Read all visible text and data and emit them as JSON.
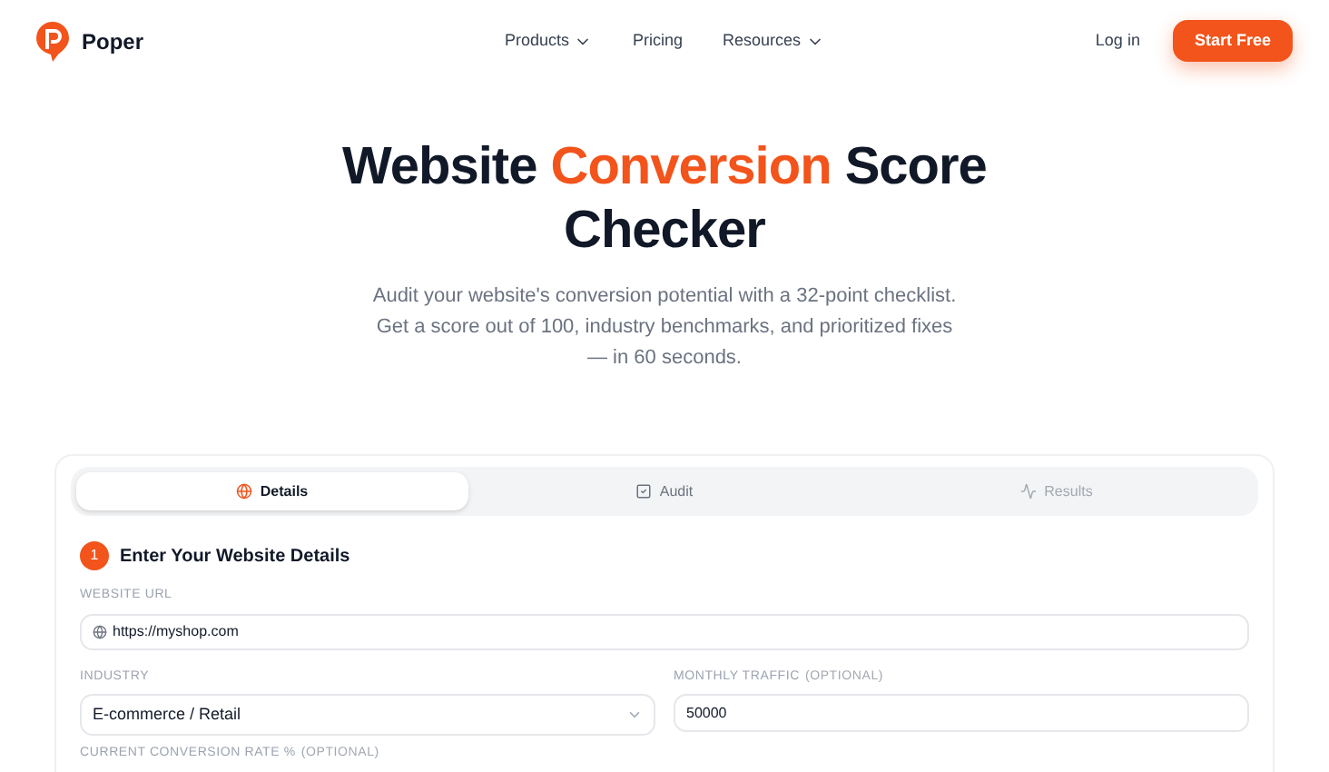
{
  "brand": {
    "name": "Poper"
  },
  "nav": [
    {
      "label": "Products",
      "dropdown": true
    },
    {
      "label": "Pricing",
      "dropdown": false
    },
    {
      "label": "Resources",
      "dropdown": true
    }
  ],
  "login": "Log in",
  "cta": "Start Free",
  "hero": {
    "title_before": "Website ",
    "title_highlight": "Conversion",
    "title_after": " Score Checker",
    "subtitle": "Audit your website's conversion potential with a 32-point checklist. Get a score out of 100, industry benchmarks, and prioritized fixes — in 60 seconds."
  },
  "tabs": [
    {
      "label": "Details",
      "kind": "globe",
      "selected": true,
      "disabled": false
    },
    {
      "label": "Audit",
      "kind": "check",
      "selected": false,
      "disabled": false
    },
    {
      "label": "Results",
      "kind": "pulse",
      "selected": false,
      "disabled": true
    }
  ],
  "step": {
    "number": "1",
    "title": "Enter Your Website Details"
  },
  "fields": {
    "url": {
      "label": "WEBSITE URL",
      "value": "https://myshop.com"
    },
    "industry": {
      "label": "INDUSTRY",
      "value": "E-commerce / Retail"
    },
    "traffic": {
      "label": "MONTHLY TRAFFIC",
      "optional": "(OPTIONAL)",
      "value": "50000"
    },
    "conversion": {
      "label": "CURRENT CONVERSION RATE %",
      "optional": "(OPTIONAL)"
    }
  }
}
